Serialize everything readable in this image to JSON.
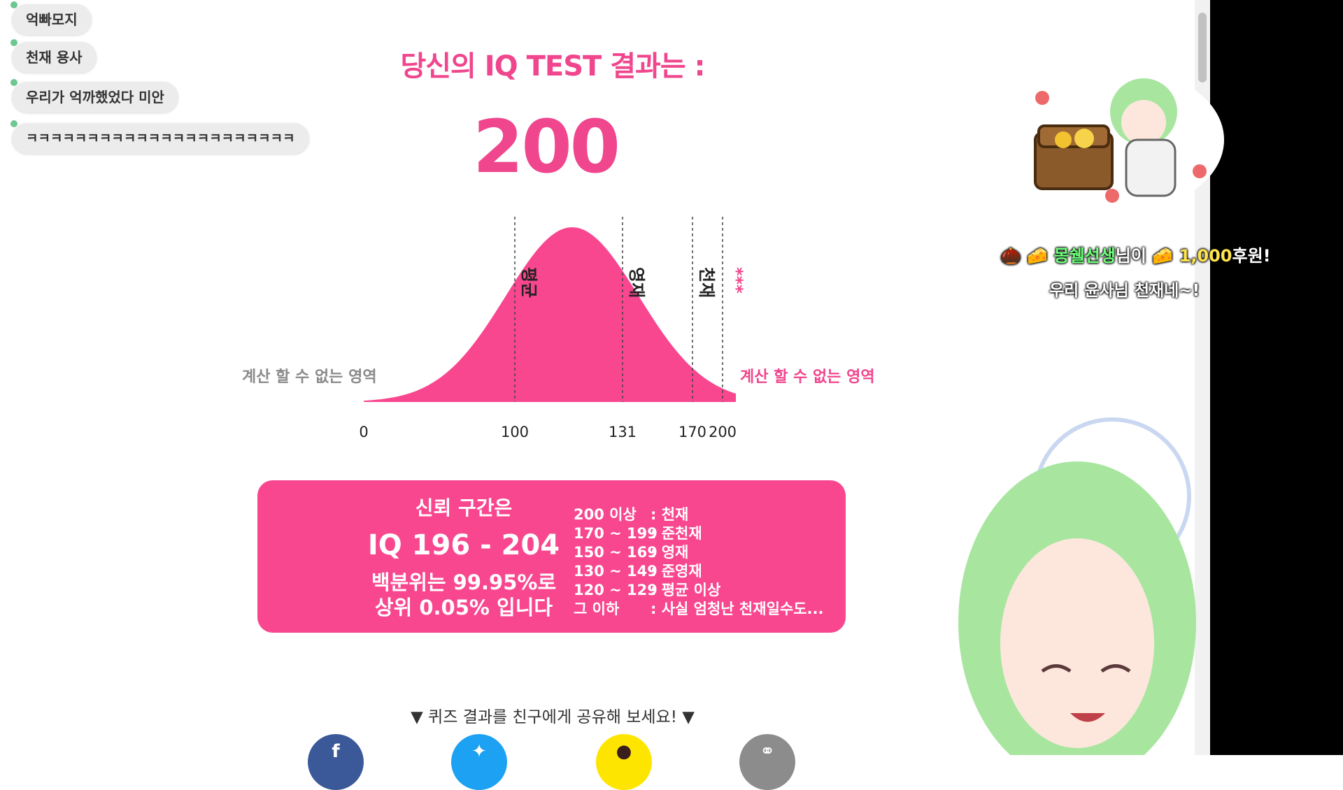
{
  "chat": {
    "messages": [
      "억빠모지",
      "천재 용사",
      "우리가 억까했었다 미안",
      "ㅋㅋㅋㅋㅋㅋㅋㅋㅋㅋㅋㅋㅋㅋㅋㅋㅋㅋㅋㅋㅋㅋ"
    ]
  },
  "result": {
    "title": "당신의 IQ TEST 결과는 :",
    "score": "200"
  },
  "chart_data": {
    "type": "area",
    "x_ticks": [
      0,
      100,
      131,
      170,
      200
    ],
    "markers": [
      {
        "x": 100,
        "label": "평균"
      },
      {
        "x": 131,
        "label": "영재"
      },
      {
        "x": 170,
        "label": "천재"
      },
      {
        "x": 200,
        "label": "***"
      }
    ],
    "left_region_label": "계산 할 수 없는 영역",
    "right_region_label": "계산 할 수 없는 영역",
    "fill_color": "#f8478f"
  },
  "info_box": {
    "heading": "신뢰 구간은",
    "range": "IQ 196 - 204",
    "percentile_line1": "백분위는 99.95%로",
    "percentile_line2": "상위 0.05% 입니다",
    "legend": [
      {
        "range": "200 이상",
        "label": ": 천재"
      },
      {
        "range": "170 ~ 199",
        "label": ": 준천재"
      },
      {
        "range": "150 ~ 169",
        "label": ": 영재"
      },
      {
        "range": "130 ~ 149",
        "label": ": 준영재"
      },
      {
        "range": "120 ~ 129",
        "label": ": 평균 이상"
      },
      {
        "range": "그 이하",
        "label": ": 사실 엄청난 천재일수도..."
      }
    ]
  },
  "share": {
    "text": "▼ 퀴즈 결과를 친구에게 공유해 보세요! ▼",
    "buttons": [
      {
        "name": "facebook",
        "color": "#3b5998"
      },
      {
        "name": "twitter",
        "color": "#1da1f2"
      },
      {
        "name": "kakao",
        "color": "#fee500"
      },
      {
        "name": "link",
        "color": "#888888"
      }
    ]
  },
  "donation": {
    "name": "몽쉘선생",
    "suffix": "님이",
    "amount": "1,000",
    "unit": "후원!",
    "message": "우리 윤사님 천재네~!"
  }
}
